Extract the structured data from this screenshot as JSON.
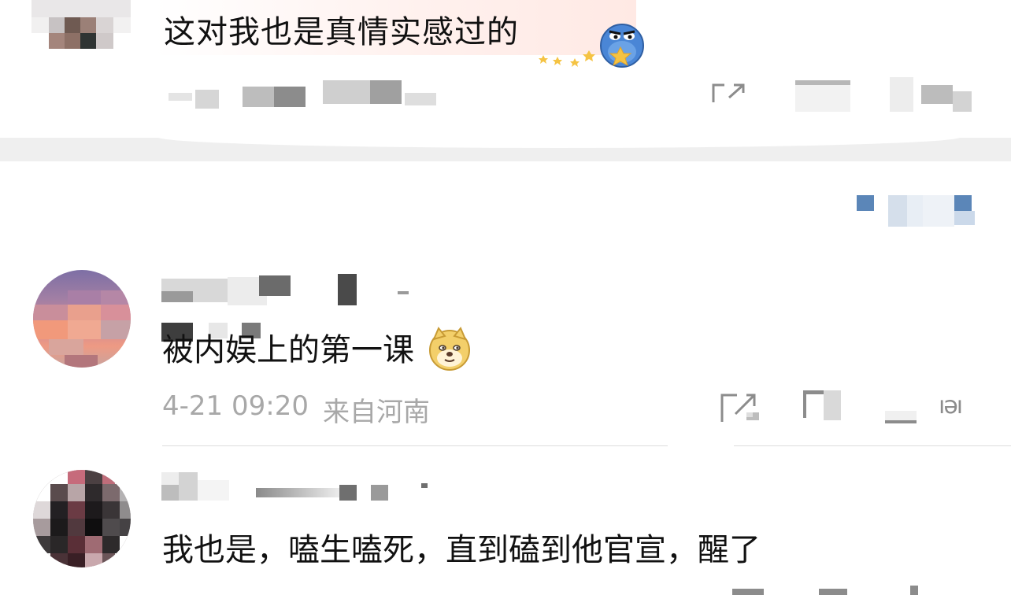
{
  "comments": [
    {
      "text": "这对我也是真情实感过的",
      "sticker": "stars-blob-sticker"
    },
    {
      "text": "被内娱上的第一课",
      "emoji": "doge-emoji",
      "time": "4-21 09:20",
      "location": "来自河南"
    },
    {
      "text": "我也是，嗑生嗑死，直到磕到他官宣，醒了"
    }
  ],
  "icons": {
    "share": "share-icon",
    "comment": "comment-icon",
    "like": "like-icon"
  },
  "colors": {
    "meta_text": "#a8a8a8",
    "link_blue": "#5b86b8",
    "divider_band": "#efefef"
  }
}
